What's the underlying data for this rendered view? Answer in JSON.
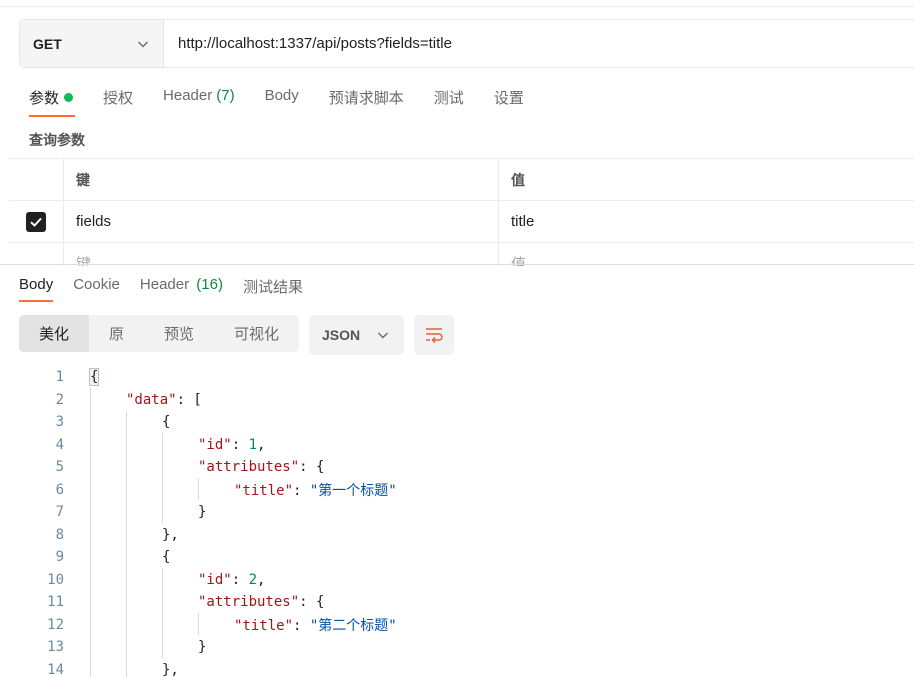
{
  "request": {
    "method": "GET",
    "url": "http://localhost:1337/api/posts?fields=title",
    "tabs": [
      {
        "label": "参数",
        "active": true,
        "dot": true
      },
      {
        "label": "授权"
      },
      {
        "label": "Header",
        "count": "(7)"
      },
      {
        "label": "Body"
      },
      {
        "label": "预请求脚本"
      },
      {
        "label": "测试"
      },
      {
        "label": "设置"
      }
    ],
    "params_title": "查询参数",
    "params_header": {
      "key": "键",
      "value": "值"
    },
    "params": [
      {
        "key": "fields",
        "value": "title",
        "checked": true
      }
    ],
    "placeholder": {
      "key": "键",
      "value": "值"
    }
  },
  "response": {
    "tabs": [
      {
        "label": "Body",
        "active": true
      },
      {
        "label": "Cookie"
      },
      {
        "label": "Header",
        "count": "(16)"
      },
      {
        "label": "测试结果"
      }
    ],
    "views": [
      "美化",
      "原",
      "预览",
      "可视化"
    ],
    "format": "JSON"
  },
  "code_lines": [
    {
      "n": "1",
      "indent": 0,
      "parts": [
        [
          "p",
          "{"
        ]
      ]
    },
    {
      "n": "2",
      "indent": 1,
      "parts": [
        [
          "k",
          "\"data\""
        ],
        [
          "p",
          ": ["
        ]
      ]
    },
    {
      "n": "3",
      "indent": 2,
      "parts": [
        [
          "p",
          "{"
        ]
      ]
    },
    {
      "n": "4",
      "indent": 3,
      "parts": [
        [
          "k",
          "\"id\""
        ],
        [
          "p",
          ": "
        ],
        [
          "n",
          "1"
        ],
        [
          "p",
          ","
        ]
      ]
    },
    {
      "n": "5",
      "indent": 3,
      "parts": [
        [
          "k",
          "\"attributes\""
        ],
        [
          "p",
          ": {"
        ]
      ]
    },
    {
      "n": "6",
      "indent": 4,
      "parts": [
        [
          "k",
          "\"title\""
        ],
        [
          "p",
          ": "
        ],
        [
          "s",
          "\"第一个标题\""
        ]
      ]
    },
    {
      "n": "7",
      "indent": 3,
      "parts": [
        [
          "p",
          "}"
        ]
      ]
    },
    {
      "n": "8",
      "indent": 2,
      "parts": [
        [
          "p",
          "},"
        ]
      ]
    },
    {
      "n": "9",
      "indent": 2,
      "parts": [
        [
          "p",
          "{"
        ]
      ]
    },
    {
      "n": "10",
      "indent": 3,
      "parts": [
        [
          "k",
          "\"id\""
        ],
        [
          "p",
          ": "
        ],
        [
          "n",
          "2"
        ],
        [
          "p",
          ","
        ]
      ]
    },
    {
      "n": "11",
      "indent": 3,
      "parts": [
        [
          "k",
          "\"attributes\""
        ],
        [
          "p",
          ": {"
        ]
      ]
    },
    {
      "n": "12",
      "indent": 4,
      "parts": [
        [
          "k",
          "\"title\""
        ],
        [
          "p",
          ": "
        ],
        [
          "s",
          "\"第二个标题\""
        ]
      ]
    },
    {
      "n": "13",
      "indent": 3,
      "parts": [
        [
          "p",
          "}"
        ]
      ]
    },
    {
      "n": "14",
      "indent": 2,
      "parts": [
        [
          "p",
          "},"
        ]
      ]
    }
  ],
  "icons": {
    "method_dropdown": "chevron-down-icon",
    "format_dropdown": "chevron-down-icon",
    "wrap": "wrap-lines-icon",
    "check": "check-icon"
  },
  "colors": {
    "accent": "#ff6c37",
    "active_dot": "#0cbb52",
    "count": "#0e8a3e"
  }
}
